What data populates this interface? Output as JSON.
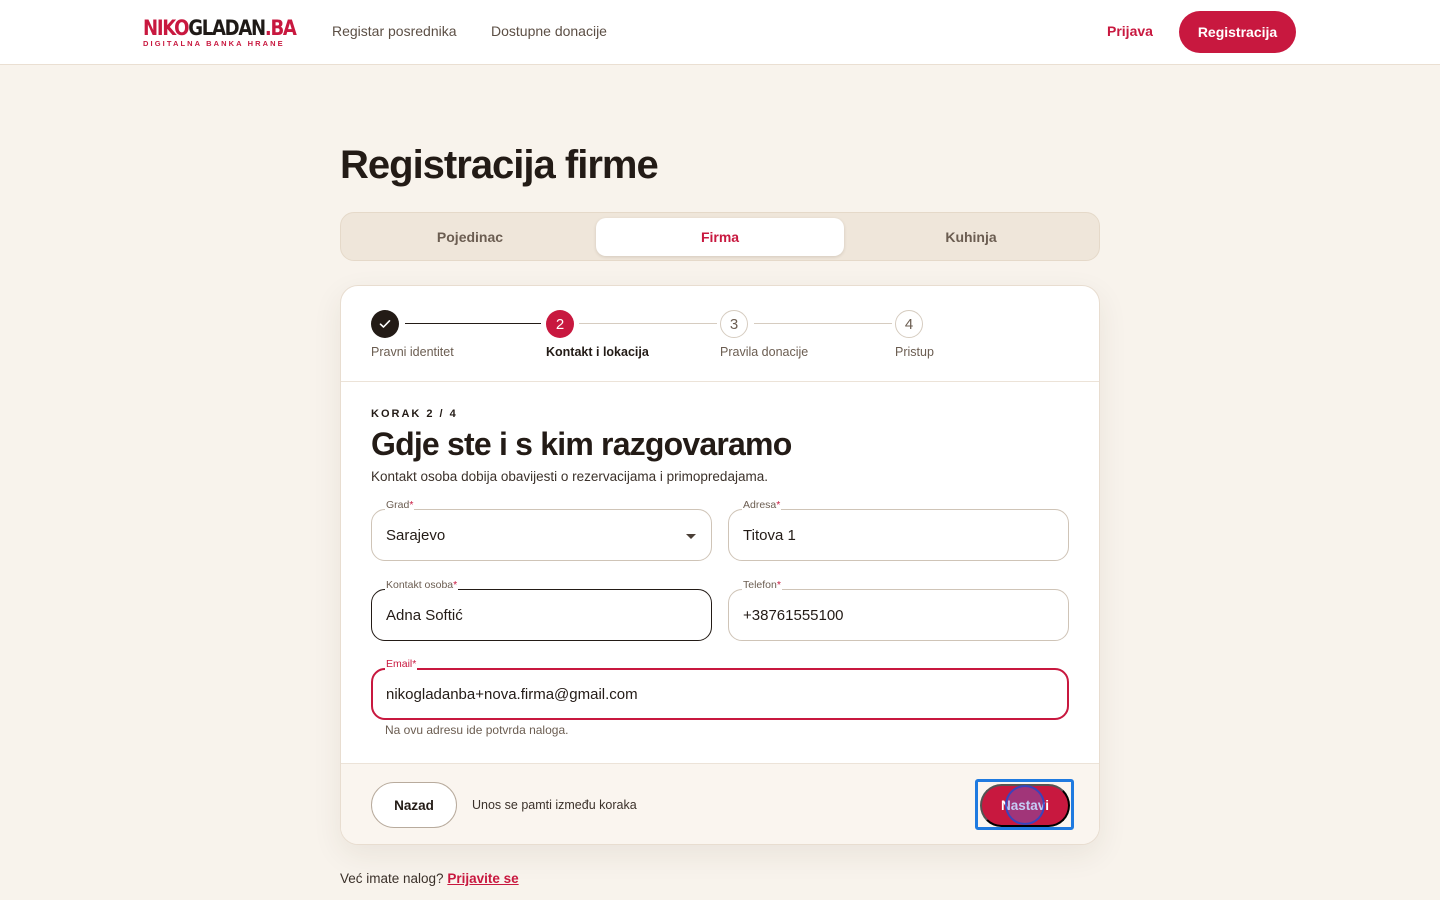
{
  "brand": {
    "logo_part1": "NIKO",
    "logo_part2": "GLADAN",
    "logo_part3": ".BA",
    "tagline": "DIGITALNA BANKA HRANE"
  },
  "nav": {
    "links": [
      "Registar posrednika",
      "Dostupne donacije"
    ],
    "login": "Prijava",
    "register": "Registracija"
  },
  "page": {
    "title": "Registracija firme"
  },
  "account_types": {
    "tabs": [
      "Pojedinac",
      "Firma",
      "Kuhinja"
    ],
    "active": "Firma"
  },
  "stepper": {
    "steps": [
      {
        "label": "Pravni identitet",
        "number": "",
        "state": "done"
      },
      {
        "label": "Kontakt i lokacija",
        "number": "2",
        "state": "current"
      },
      {
        "label": "Pravila donacije",
        "number": "3",
        "state": "todo"
      },
      {
        "label": "Pristup",
        "number": "4",
        "state": "todo"
      }
    ],
    "done_icon": "check-icon"
  },
  "form": {
    "kicker": "KORAK 2 / 4",
    "title": "Gdje ste i s kim razgovaramo",
    "subtitle": "Kontakt osoba dobija obavijesti o rezervacijama i primopredajama.",
    "required_mark": "*",
    "fields": {
      "city": {
        "label": "Grad",
        "value": "Sarajevo"
      },
      "address": {
        "label": "Adresa",
        "value": "Titova 1"
      },
      "contact": {
        "label": "Kontakt osoba",
        "value": "Adna Softić"
      },
      "phone": {
        "label": "Telefon",
        "value": "+38761555100"
      },
      "email": {
        "label": "Email",
        "value": "nikogladanba+nova.firma@gmail.com",
        "helper": "Na ovu adresu ide potvrda naloga."
      }
    }
  },
  "footer": {
    "back": "Nazad",
    "note": "Unos se pamti između koraka",
    "next": "Nastavi"
  },
  "bottom": {
    "question": "Već imate nalog?",
    "link": "Prijavite se"
  },
  "colors": {
    "accent": "#c8183f",
    "background": "#f8f3ec",
    "text": "#231b16",
    "focus_ring": "#1f7ae0"
  }
}
